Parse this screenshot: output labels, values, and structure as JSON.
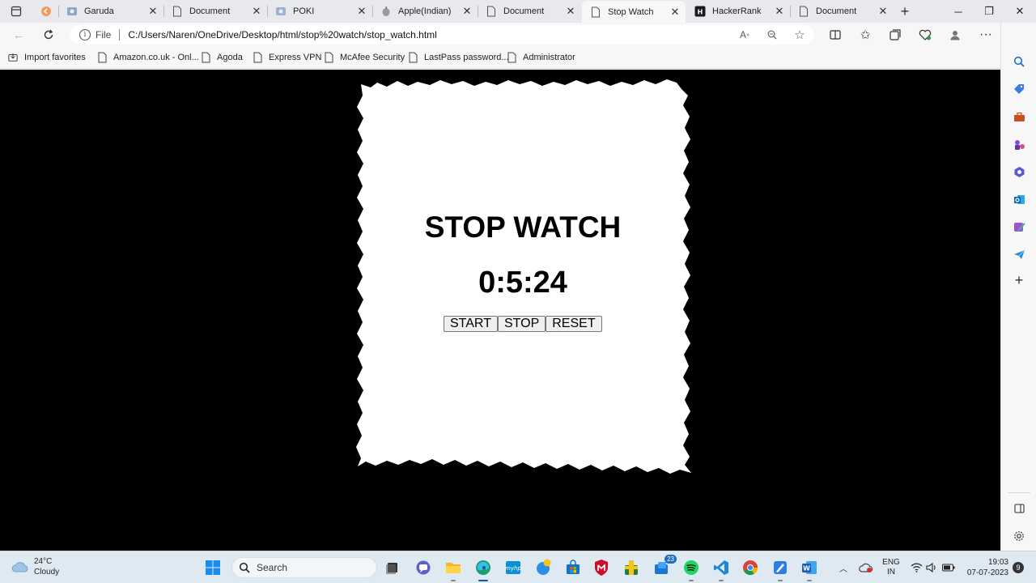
{
  "tabs": [
    {
      "title": "Garuda",
      "favicon": "garuda-favicon"
    },
    {
      "title": "Document",
      "favicon": "page-icon"
    },
    {
      "title": "POKI",
      "favicon": "poki-favicon"
    },
    {
      "title": "Apple(Indian)",
      "favicon": "apple-favicon"
    },
    {
      "title": "Document",
      "favicon": "page-icon"
    },
    {
      "title": "Stop Watch",
      "favicon": "page-icon",
      "active": true
    },
    {
      "title": "HackerRank",
      "favicon": "hackerrank-favicon"
    },
    {
      "title": "Document",
      "favicon": "page-icon"
    }
  ],
  "address": {
    "protocol_label": "File",
    "url": "C:/Users/Naren/OneDrive/Desktop/html/stop%20watch/stop_watch.html"
  },
  "favorites": [
    {
      "label": "Import favorites"
    },
    {
      "label": "Amazon.co.uk - Onl..."
    },
    {
      "label": "Agoda"
    },
    {
      "label": "Express VPN"
    },
    {
      "label": "McAfee Security"
    },
    {
      "label": "LastPass password..."
    },
    {
      "label": "Administrator"
    }
  ],
  "stopwatch": {
    "title": "STOP WATCH",
    "time": "0:5:24",
    "buttons": {
      "start": "START",
      "stop": "STOP",
      "reset": "RESET"
    }
  },
  "taskbar": {
    "weather": {
      "temp": "24°C",
      "condition": "Cloudy"
    },
    "search_label": "Search",
    "teams_badge": "23",
    "language": {
      "line1": "ENG",
      "line2": "IN"
    },
    "clock": {
      "time": "19:03",
      "date": "07-07-2023"
    },
    "notifications": "9"
  },
  "colors": {
    "page_background": "#000000",
    "paper": "#ffffff",
    "edge_blue": "#0c59a4"
  }
}
